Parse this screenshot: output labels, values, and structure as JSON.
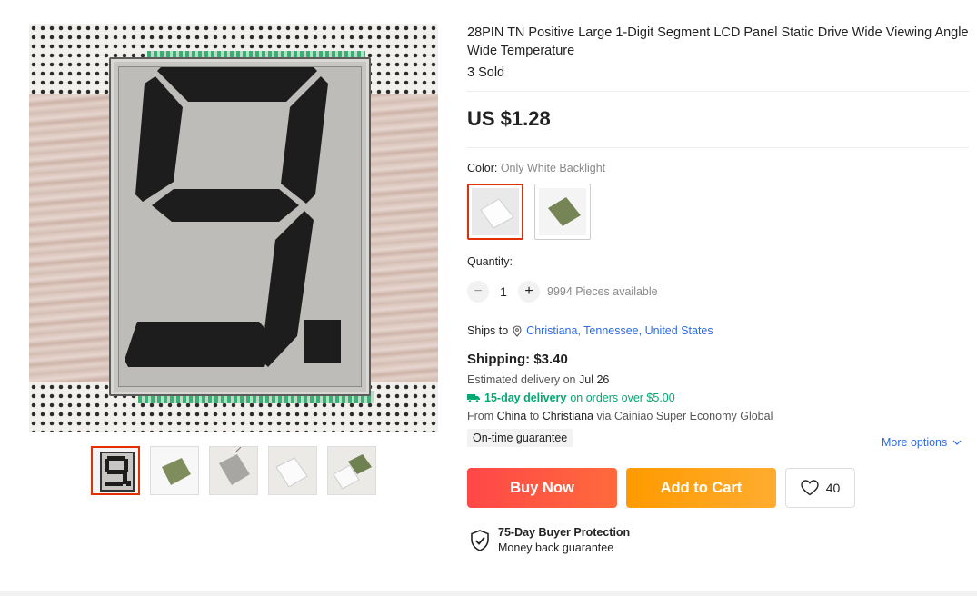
{
  "product": {
    "title": "28PIN TN Positive Large 1-Digit Segment LCD Panel Static Drive Wide Viewing Angle Wide Temperature",
    "sold": "3 Sold",
    "price": "US $1.28"
  },
  "gallery": {
    "main_image_icon": "lcd-segment-9-photo",
    "thumbnails": [
      {
        "icon": "lcd-digit-9-thumb",
        "active": true
      },
      {
        "icon": "green-lcd-panel-thumb",
        "active": false
      },
      {
        "icon": "silver-panel-thumb",
        "active": false
      },
      {
        "icon": "white-panel-thumb",
        "active": false
      },
      {
        "icon": "white-green-panel-thumb",
        "active": false
      }
    ]
  },
  "color": {
    "label": "Color:",
    "selected": "Only White Backlight",
    "options": [
      {
        "icon": "white-backlight-swatch",
        "selected": true
      },
      {
        "icon": "green-backlight-swatch",
        "selected": false
      }
    ]
  },
  "quantity": {
    "label": "Quantity:",
    "minus": "−",
    "value": "1",
    "plus": "+",
    "available": "9994 Pieces available"
  },
  "shipping": {
    "ships_to_label": "Ships to",
    "destination": "Christiana, Tennessee, United States",
    "cost": "Shipping: $3.40",
    "estimated_prefix": "Estimated delivery on",
    "estimated_date": "Jul 26",
    "fast_delivery": "15-day delivery",
    "fast_delivery_suffix": "on orders over $5.00",
    "from_label": "From",
    "from": "China",
    "to_label": "to",
    "to": "Christiana",
    "via": "via Cainiao Super Economy Global",
    "guarantee_badge": "On-time guarantee",
    "more_options": "More options"
  },
  "actions": {
    "buy_now": "Buy Now",
    "add_to_cart": "Add to Cart",
    "wishlist_count": "40"
  },
  "protection": {
    "title": "75-Day Buyer Protection",
    "subtitle": "Money back guarantee"
  },
  "colors": {
    "accent_red": "#e62e04",
    "buy_gradient": "#ff4747",
    "cart_gradient": "#ff9a00",
    "link_blue": "#2e6be6",
    "green": "#01a971"
  }
}
